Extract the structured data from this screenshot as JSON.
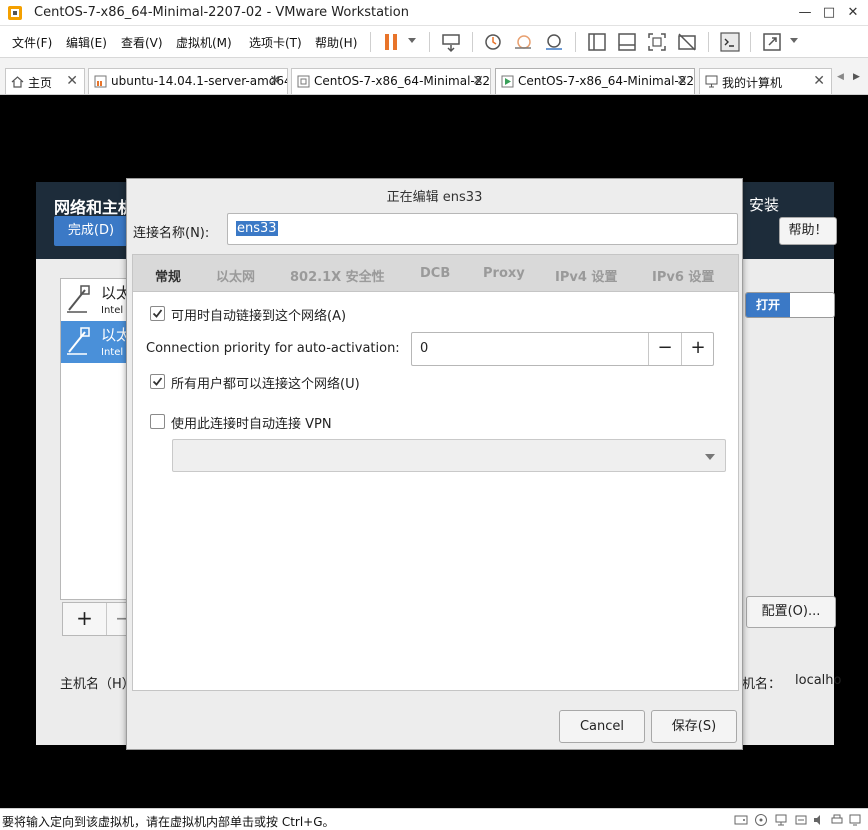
{
  "window": {
    "title": "CentOS-7-x86_64-Minimal-2207-02 - VMware Workstation",
    "minimize": "—",
    "maximize": "□",
    "close": "✕"
  },
  "menu": {
    "items": [
      "文件(F)",
      "编辑(E)",
      "查看(V)",
      "虚拟机(M)",
      "选项卡(T)",
      "帮助(H)"
    ]
  },
  "toolbar": {
    "icons": [
      "pause-icon",
      "send-keys-icon",
      "snapshot-icon",
      "revert-snapshot-icon",
      "snapshot-manager-icon",
      "sidebar-icon",
      "thumbnail-icon",
      "fullscreen-icon",
      "unity-icon",
      "console-icon",
      "stretch-icon"
    ]
  },
  "tabs": [
    {
      "label": "主页",
      "icon": "home-icon"
    },
    {
      "label": "ubuntu-14.04.1-server-amd64",
      "icon": "vm-icon"
    },
    {
      "label": "CentOS-7-x86_64-Minimal-22...",
      "icon": "vm-icon"
    },
    {
      "label": "CentOS-7-x86_64-Minimal-22...",
      "icon": "vm-running-icon"
    },
    {
      "label": "我的计算机",
      "icon": "computer-icon"
    }
  ],
  "tab_close": "✕",
  "tab_scroll": {
    "left": "◀",
    "right": "▶"
  },
  "anaconda": {
    "title": "网络和主机",
    "done_button": "完成(D)",
    "install_label": "安装",
    "help_button": "帮助！",
    "devices": [
      {
        "name": "以太",
        "sub": "Intel"
      },
      {
        "name": "以太",
        "sub": "Intel"
      }
    ],
    "add_button": "+",
    "remove_button": "−",
    "toggle_on_label": "打开",
    "config_button": "配置(O)...",
    "hostname_label": "主机名（H）",
    "current_hostname_label": "机名：",
    "current_hostname_value": "localho"
  },
  "dialog": {
    "title": "正在编辑 ens33",
    "connection_name_label": "连接名称(N):",
    "connection_name_value": "ens33",
    "tabs": [
      "常规",
      "以太网",
      "802.1X 安全性",
      "DCB",
      "Proxy",
      "IPv4 设置",
      "IPv6 设置"
    ],
    "active_tab": "常规",
    "auto_connect": {
      "label": "可用时自动链接到这个网络(A)",
      "checked": true
    },
    "priority": {
      "label": "Connection priority for auto-activation:",
      "value": "0",
      "minus": "−",
      "plus": "+"
    },
    "all_users": {
      "label": "所有用户都可以连接这个网络(U)",
      "checked": true
    },
    "vpn": {
      "label": "使用此连接时自动连接 VPN",
      "checked": false,
      "selected": ""
    },
    "cancel_button": "Cancel",
    "save_button": "保存(S)"
  },
  "statusbar": {
    "text": "要将输入定向到该虚拟机，请在虚拟机内部单击或按 Ctrl+G。",
    "icons": [
      "hdd-icon",
      "cdrom-icon",
      "network-icon",
      "usb-icon",
      "sound-icon",
      "printer-icon",
      "display-icon"
    ]
  },
  "colors": {
    "accent": "#3b79c6",
    "anaconda_header": "#1d2c3a",
    "pause_orange": "#e8742a"
  }
}
